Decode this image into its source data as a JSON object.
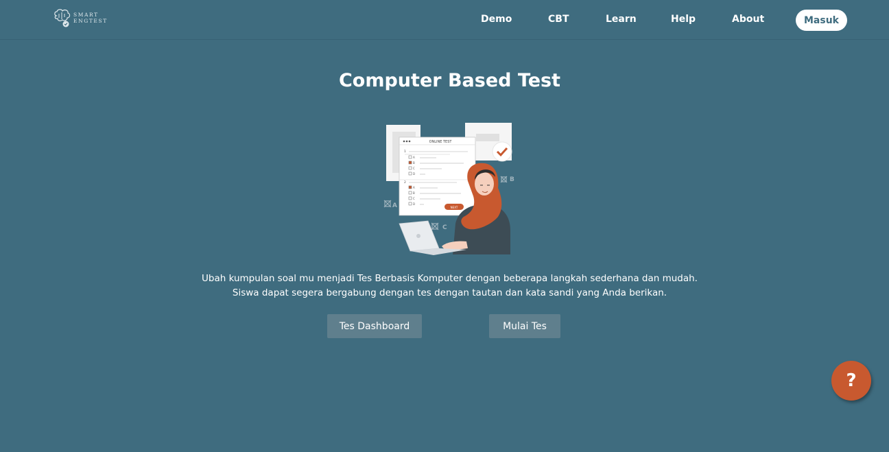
{
  "brand": {
    "logo_line1": "SMART",
    "logo_line2": "ENGTEST"
  },
  "nav": {
    "items": [
      {
        "label": "Demo"
      },
      {
        "label": "CBT"
      },
      {
        "label": "Learn"
      },
      {
        "label": "Help"
      },
      {
        "label": "About"
      }
    ],
    "login_label": "Masuk"
  },
  "main": {
    "title": "Computer Based Test",
    "description_line1": "Ubah kumpulan soal mu menjadi Tes Berbasis Komputer dengan beberapa langkah sederhana dan mudah.",
    "description_line2": "Siswa dapat segera bergabung dengan tes dengan tautan dan kata sandi yang Anda berikan.",
    "buttons": {
      "dashboard_label": "Tes Dashboard",
      "start_label": "Mulai Tes"
    }
  },
  "illustration": {
    "sheet_title": "ONLINE TEST",
    "q1_number": "1",
    "q2_number": "2",
    "options": [
      "A",
      "B",
      "C",
      "D"
    ],
    "next_label": "NEXT",
    "mark_a": "A",
    "mark_b": "B",
    "mark_c": "C"
  },
  "help": {
    "icon_glyph": "?"
  },
  "colors": {
    "background": "#3f6c7f",
    "button_bg": "#5f7f8d",
    "help_fab": "#c8592f",
    "accent_orange": "#c8592f"
  }
}
